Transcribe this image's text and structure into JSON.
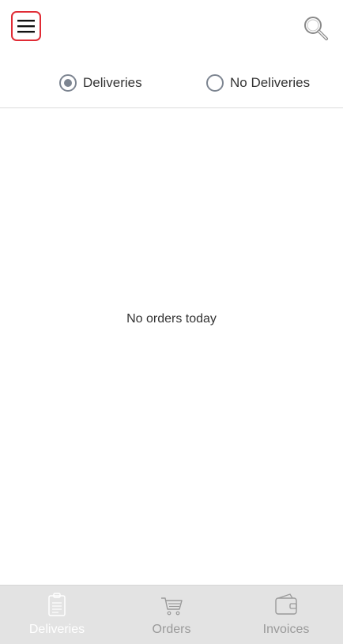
{
  "header": {
    "menu_icon": "hamburger-menu-icon",
    "search_icon": "search-icon"
  },
  "filter": {
    "options": [
      {
        "label": "Deliveries",
        "selected": true
      },
      {
        "label": "No Deliveries",
        "selected": false
      }
    ]
  },
  "content": {
    "empty_message": "No orders today"
  },
  "tabs": [
    {
      "label": "Deliveries",
      "icon": "clipboard-icon",
      "active": true
    },
    {
      "label": "Orders",
      "icon": "shopping-cart-icon",
      "active": false
    },
    {
      "label": "Invoices",
      "icon": "wallet-icon",
      "active": false
    }
  ],
  "colors": {
    "menu_highlight": "#e02b35",
    "radio": "#7d8591",
    "tab_bar_bg": "#e3e3e3",
    "tab_active_label": "#ffffff",
    "tab_inactive_label": "#9a9a9a"
  }
}
